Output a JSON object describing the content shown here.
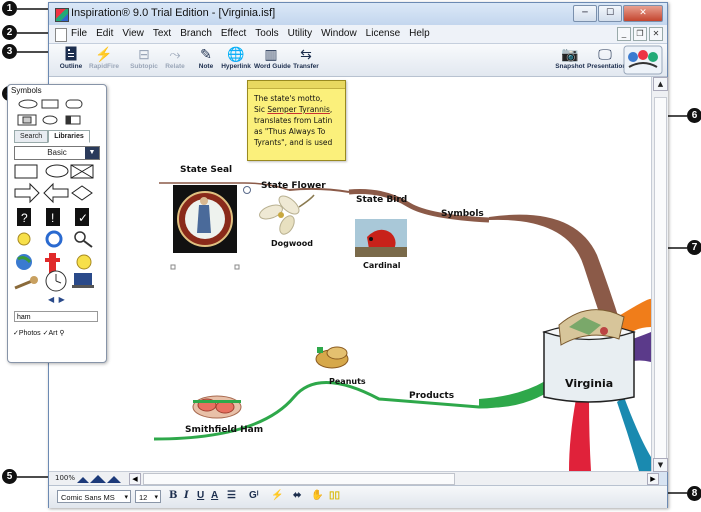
{
  "window": {
    "title": "Inspiration® 9.0 Trial Edition - [Virginia.isf]",
    "controls": {
      "minimize": "─",
      "maximize": "☐",
      "close": "✕"
    }
  },
  "menubar": {
    "items": [
      "File",
      "Edit",
      "View",
      "Text",
      "Branch",
      "Effect",
      "Tools",
      "Utility",
      "Window",
      "License",
      "Help"
    ],
    "mdi": {
      "minimize": "_",
      "restore": "❐",
      "close": "✕"
    }
  },
  "toolbar": {
    "outline": "Outline",
    "rapidfire": "RapidFire",
    "subtopic": "Subtopic",
    "relate": "Relate",
    "note": "Note",
    "hyperlink": "Hyperlink",
    "word_guide": "Word Guide",
    "transfer": "Transfer",
    "snapshot": "Snapshot",
    "presentation": "Presentation"
  },
  "symbols_panel": {
    "title": "Symbols",
    "tab_search": "Search",
    "tab_libraries": "Libraries",
    "category": "Basic",
    "search_value": "ham",
    "photos": "Photos",
    "art": "Art"
  },
  "note": {
    "line1": "The state's motto,",
    "line2_pre": "Sic ",
    "line2_link": "Semper Tyrannis",
    "line2_post": ",",
    "line3": "translates from Latin",
    "line4": "as \"Thus Always To",
    "line5": "Tyrants\", and is used"
  },
  "diagram": {
    "main_idea": "Virginia",
    "state_seal": "State Seal",
    "state_flower": "State Flower",
    "dogwood": "Dogwood",
    "state_bird": "State Bird",
    "cardinal": "Cardinal",
    "symbols_branch": "Symbols",
    "peanuts": "Peanuts",
    "products": "Products",
    "smithfield_ham": "Smithfield Ham"
  },
  "status": {
    "zoom": "100%"
  },
  "formatting": {
    "font": "Comic Sans MS",
    "size": "12",
    "bold": "B",
    "italic": "I",
    "underline": "U",
    "color_a": "A"
  },
  "callouts": [
    "1",
    "2",
    "3",
    "4",
    "5",
    "6",
    "7",
    "8"
  ],
  "colors": {
    "branch_brown": "#8b5a48",
    "branch_green": "#2ea84a",
    "branch_orange": "#f07d1a",
    "branch_purple": "#5b3a8a",
    "branch_red": "#e0223a",
    "branch_teal": "#1a8ab0",
    "note_yellow": "#fbf07b"
  }
}
